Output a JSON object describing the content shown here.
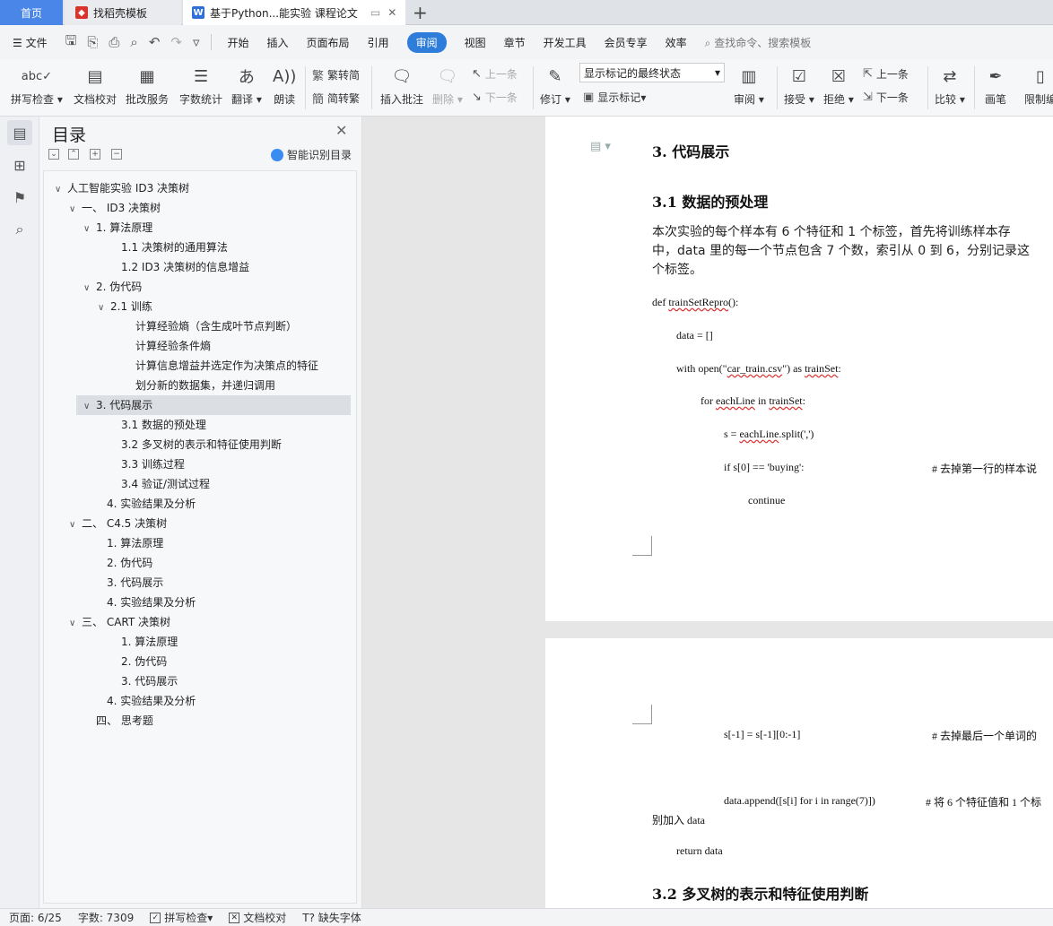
{
  "tabs": {
    "home": "首页",
    "template": "找稻壳模板",
    "document": "基于Python...能实验 课程论文"
  },
  "menu": {
    "file": "文件",
    "items": [
      "开始",
      "插入",
      "页面布局",
      "引用",
      "审阅",
      "视图",
      "章节",
      "开发工具",
      "会员专享",
      "效率"
    ],
    "active_index": 4,
    "search": "查找命令、搜索模板"
  },
  "ribbon": {
    "spell_check": "拼写检查",
    "doc_proofread": "文档校对",
    "annotate_service": "批改服务",
    "word_count": "字数统计",
    "translate": "翻译",
    "read_aloud": "朗读",
    "to_traditional": "繁转简",
    "to_simplified": "简转繁",
    "insert_comment": "插入批注",
    "delete": "删除",
    "prev": "上一条",
    "next": "下一条",
    "revise": "修订",
    "markup_state": "显示标记的最终状态",
    "show_markup": "显示标记",
    "review": "审阅",
    "accept": "接受",
    "reject": "拒绝",
    "prev2": "上一条",
    "next2": "下一条",
    "compare": "比较",
    "pen": "画笔",
    "restrict": "限制编"
  },
  "toc": {
    "title": "目录",
    "ai_toc": "智能识别目录",
    "items": [
      {
        "text": "人工智能实验 ID3 决策树"
      },
      {
        "text": "一、 ID3 决策树"
      },
      {
        "text": "1. 算法原理"
      },
      {
        "text": "1.1 决策树的通用算法"
      },
      {
        "text": "1.2 ID3 决策树的信息增益"
      },
      {
        "text": "2. 伪代码"
      },
      {
        "text": "2.1 训练"
      },
      {
        "text": "计算经验熵（含生成叶节点判断）"
      },
      {
        "text": "计算经验条件熵"
      },
      {
        "text": "计算信息增益并选定作为决策点的特征"
      },
      {
        "text": "划分新的数据集，并递归调用"
      },
      {
        "text": "3. 代码展示"
      },
      {
        "text": "3.1 数据的预处理"
      },
      {
        "text": "3.2 多叉树的表示和特征使用判断"
      },
      {
        "text": "3.3 训练过程"
      },
      {
        "text": "3.4 验证/测试过程"
      },
      {
        "text": "4. 实验结果及分析"
      },
      {
        "text": "二、 C4.5 决策树"
      },
      {
        "text": "1. 算法原理"
      },
      {
        "text": "2. 伪代码"
      },
      {
        "text": "3. 代码展示"
      },
      {
        "text": "4. 实验结果及分析"
      },
      {
        "text": "三、 CART 决策树"
      },
      {
        "text": "1. 算法原理"
      },
      {
        "text": "2. 伪代码"
      },
      {
        "text": "3. 代码展示"
      },
      {
        "text": "4. 实验结果及分析"
      },
      {
        "text": "四、 思考题"
      }
    ]
  },
  "doc": {
    "h_code": "3.  代码展示",
    "h_preprocess": "3.1  数据的预处理",
    "para1_l1": "本次实验的每个样本有 6 个特征和 1 个标签，首先将训练样本存",
    "para1_l2": "中，data 里的每一个节点包含 7 个数，索引从 0 到 6，分别记录这",
    "para1_l3": "个标签。",
    "c1_a": "def ",
    "c1_b": "trainSetRepro",
    "c1_c": "():",
    "c2": "data = []",
    "c3_a": "with open(\"",
    "c3_b": "car_train.csv",
    "c3_c": "\") as ",
    "c3_d": "trainSet",
    "c3_e": ":",
    "c4_a": "for ",
    "c4_b": "eachLine",
    "c4_c": " in ",
    "c4_d": "trainSet",
    "c4_e": ":",
    "c5_a": "s = ",
    "c5_b": "eachLine",
    "c5_c": ".split(',')",
    "c6": "if s[0] == 'buying':",
    "c6_comment": "#  去掉第一行的样本说",
    "c7": "continue",
    "c8": "s[-1] = s[-1][0:-1]",
    "c8_comment": "#  去掉最后一个单词的",
    "c9": "data.append([s[i] for i in range(7)])",
    "c9_comment": "#  将 6 个特征值和 1 个标",
    "c9_wrap": "别加入 data",
    "c10": "return data",
    "h_tree": "3.2  多叉树的表示和特征使用判断"
  },
  "status": {
    "page": "页面: 6/25",
    "words": "字数: 7309",
    "spell": "拼写检查",
    "proof": "文档校对",
    "missing_font": "缺失字体"
  },
  "colors": {
    "accent": "#2f7ddb",
    "home_tab": "#4a86e8",
    "spell_wave": "#d33"
  }
}
